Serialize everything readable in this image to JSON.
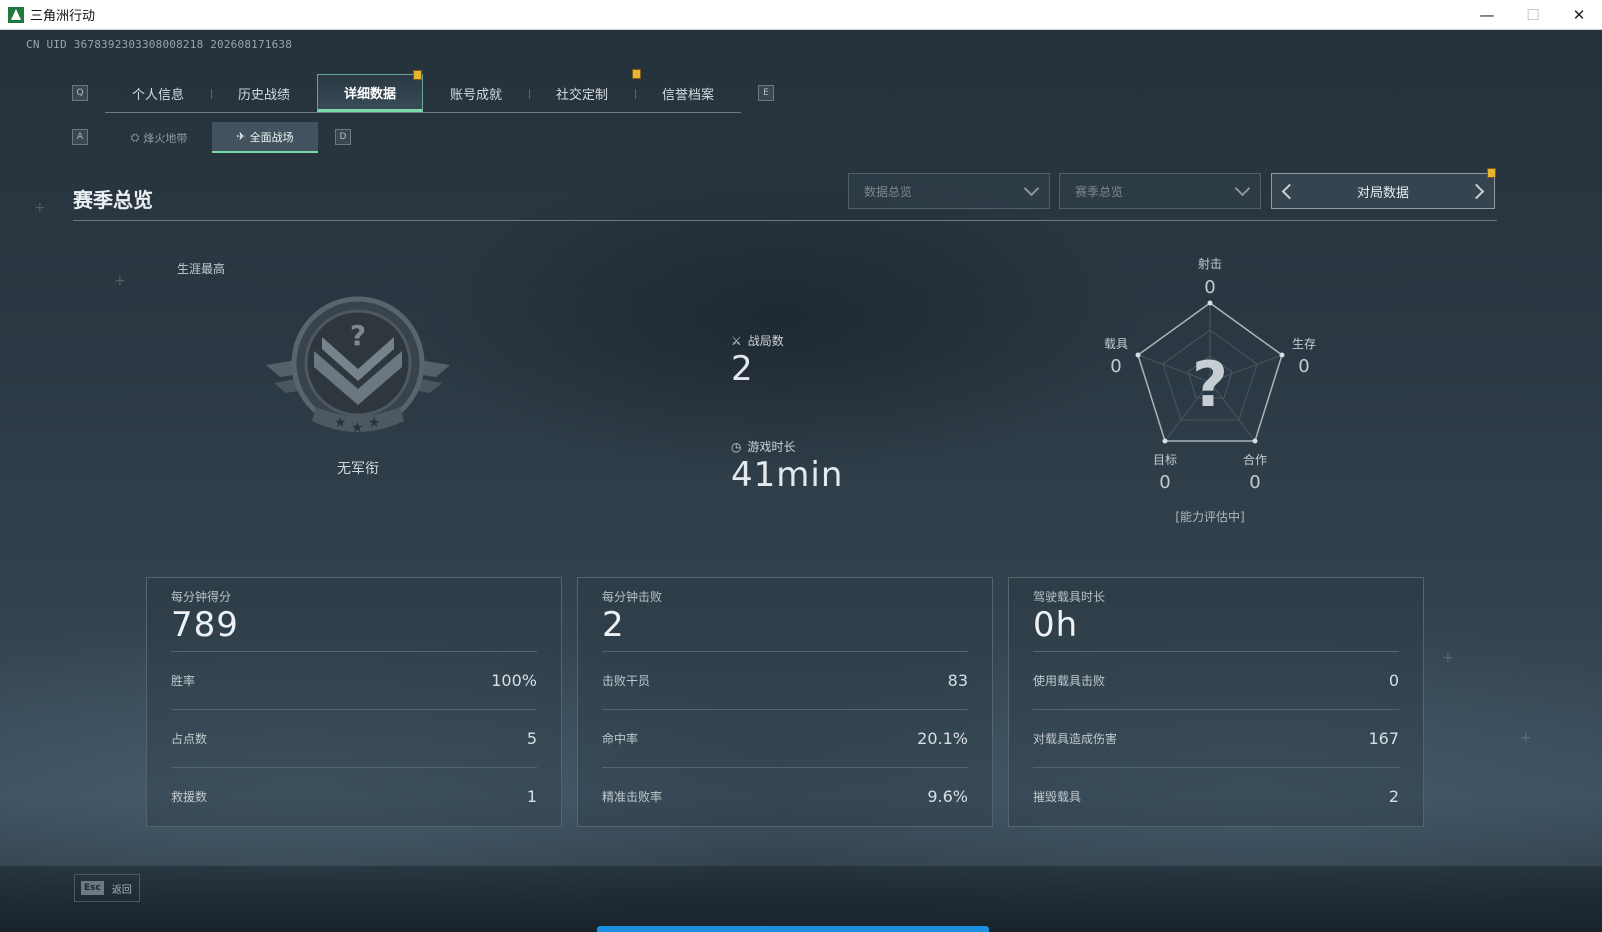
{
  "window": {
    "title": "三角洲行动",
    "minimize": "—",
    "maximize": "☐",
    "close": "✕"
  },
  "uid": "CN UID 3678392303308008218 202608171638",
  "tabs": {
    "key_left": "Q",
    "key_right": "E",
    "items": [
      {
        "label": "个人信息"
      },
      {
        "label": "历史战绩"
      },
      {
        "label": "详细数据"
      },
      {
        "label": "账号成就"
      },
      {
        "label": "社交定制"
      },
      {
        "label": "信誉档案"
      }
    ],
    "active_index": 2
  },
  "subtabs": {
    "key_left": "A",
    "key_right": "D",
    "items": [
      {
        "label": "烽火地带",
        "icon": "beacon-icon"
      },
      {
        "label": "全面战场",
        "icon": "battlefield-icon"
      }
    ],
    "active_index": 1
  },
  "section": {
    "title": "赛季总览",
    "dropdown_data": "数据总览",
    "dropdown_season": "赛季总览",
    "pager_label": "对局数据"
  },
  "rank": {
    "label": "生涯最高",
    "name": "无军衔"
  },
  "center_stats": {
    "matches_label": "战局数",
    "matches_value": "2",
    "playtime_label": "游戏时长",
    "playtime_value": "41min"
  },
  "radar": {
    "status": "[能力评估中]",
    "axes": [
      {
        "label": "射击",
        "value": "0"
      },
      {
        "label": "生存",
        "value": "0"
      },
      {
        "label": "合作",
        "value": "0"
      },
      {
        "label": "目标",
        "value": "0"
      },
      {
        "label": "载具",
        "value": "0"
      }
    ]
  },
  "cards": [
    {
      "head": "每分钟得分",
      "big": "789",
      "rows": [
        {
          "label": "胜率",
          "value": "100%"
        },
        {
          "label": "占点数",
          "value": "5"
        },
        {
          "label": "救援数",
          "value": "1"
        }
      ]
    },
    {
      "head": "每分钟击败",
      "big": "2",
      "rows": [
        {
          "label": "击败干员",
          "value": "83"
        },
        {
          "label": "命中率",
          "value": "20.1%"
        },
        {
          "label": "精准击败率",
          "value": "9.6%"
        }
      ]
    },
    {
      "head": "驾驶载具时长",
      "big": "0h",
      "rows": [
        {
          "label": "使用载具击败",
          "value": "0"
        },
        {
          "label": "对载具造成伤害",
          "value": "167"
        },
        {
          "label": "摧毁载具",
          "value": "2"
        }
      ]
    }
  ],
  "footer": {
    "esc_key": "Esc",
    "esc_label": "返回"
  },
  "colors": {
    "accent_green": "#79d9a8",
    "badge_yellow": "#e6b533",
    "loading_blue": "#1c8fe0"
  }
}
